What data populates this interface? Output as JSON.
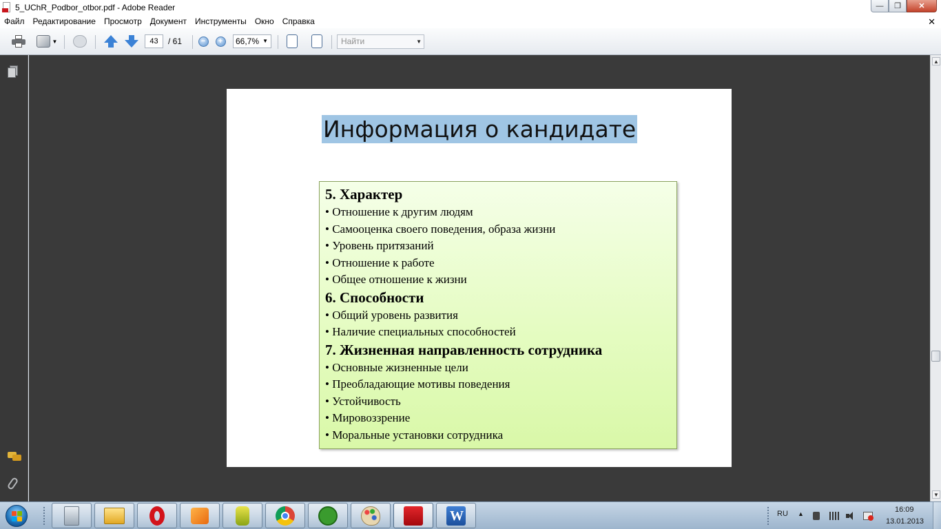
{
  "window": {
    "title": "5_UChR_Podbor_otbor.pdf - Adobe Reader"
  },
  "menu": [
    "Файл",
    "Редактирование",
    "Просмотр",
    "Документ",
    "Инструменты",
    "Окно",
    "Справка"
  ],
  "toolbar": {
    "current_page": "43",
    "page_total": "/ 61",
    "zoom": "66,7%",
    "find_placeholder": "Найти"
  },
  "slide": {
    "title": "Информация о кандидате",
    "sections": [
      {
        "heading": "5. Характер",
        "items": [
          "• Отношение к другим людям",
          "• Самооценка своего поведения, образа жизни",
          "• Уровень притязаний",
          "• Отношение к работе",
          "• Общее отношение к жизни"
        ]
      },
      {
        "heading": "6. Способности",
        "items": [
          "• Общий уровень развития",
          "• Наличие специальных способностей"
        ]
      },
      {
        "heading": "7. Жизненная направленность сотрудника",
        "items": [
          "• Основные жизненные цели",
          "• Преобладающие мотивы поведения",
          "• Устойчивость",
          "• Мировоззрение",
          "• Моральные установки сотрудника"
        ]
      }
    ]
  },
  "taskbar": {
    "apps": [
      "calculator-icon",
      "file-explorer-icon",
      "opera-icon",
      "media-player-icon",
      "robot-app-icon",
      "chrome-icon",
      "utorrent-icon",
      "paint-icon",
      "adobe-reader-icon",
      "word-icon"
    ],
    "language": "RU",
    "time": "16:09",
    "date": "13.01.2013"
  },
  "colors": {
    "title_highlight": "#9fc5e4",
    "box_fill": "#e5fcc2",
    "doc_background": "#3a3a3a"
  }
}
